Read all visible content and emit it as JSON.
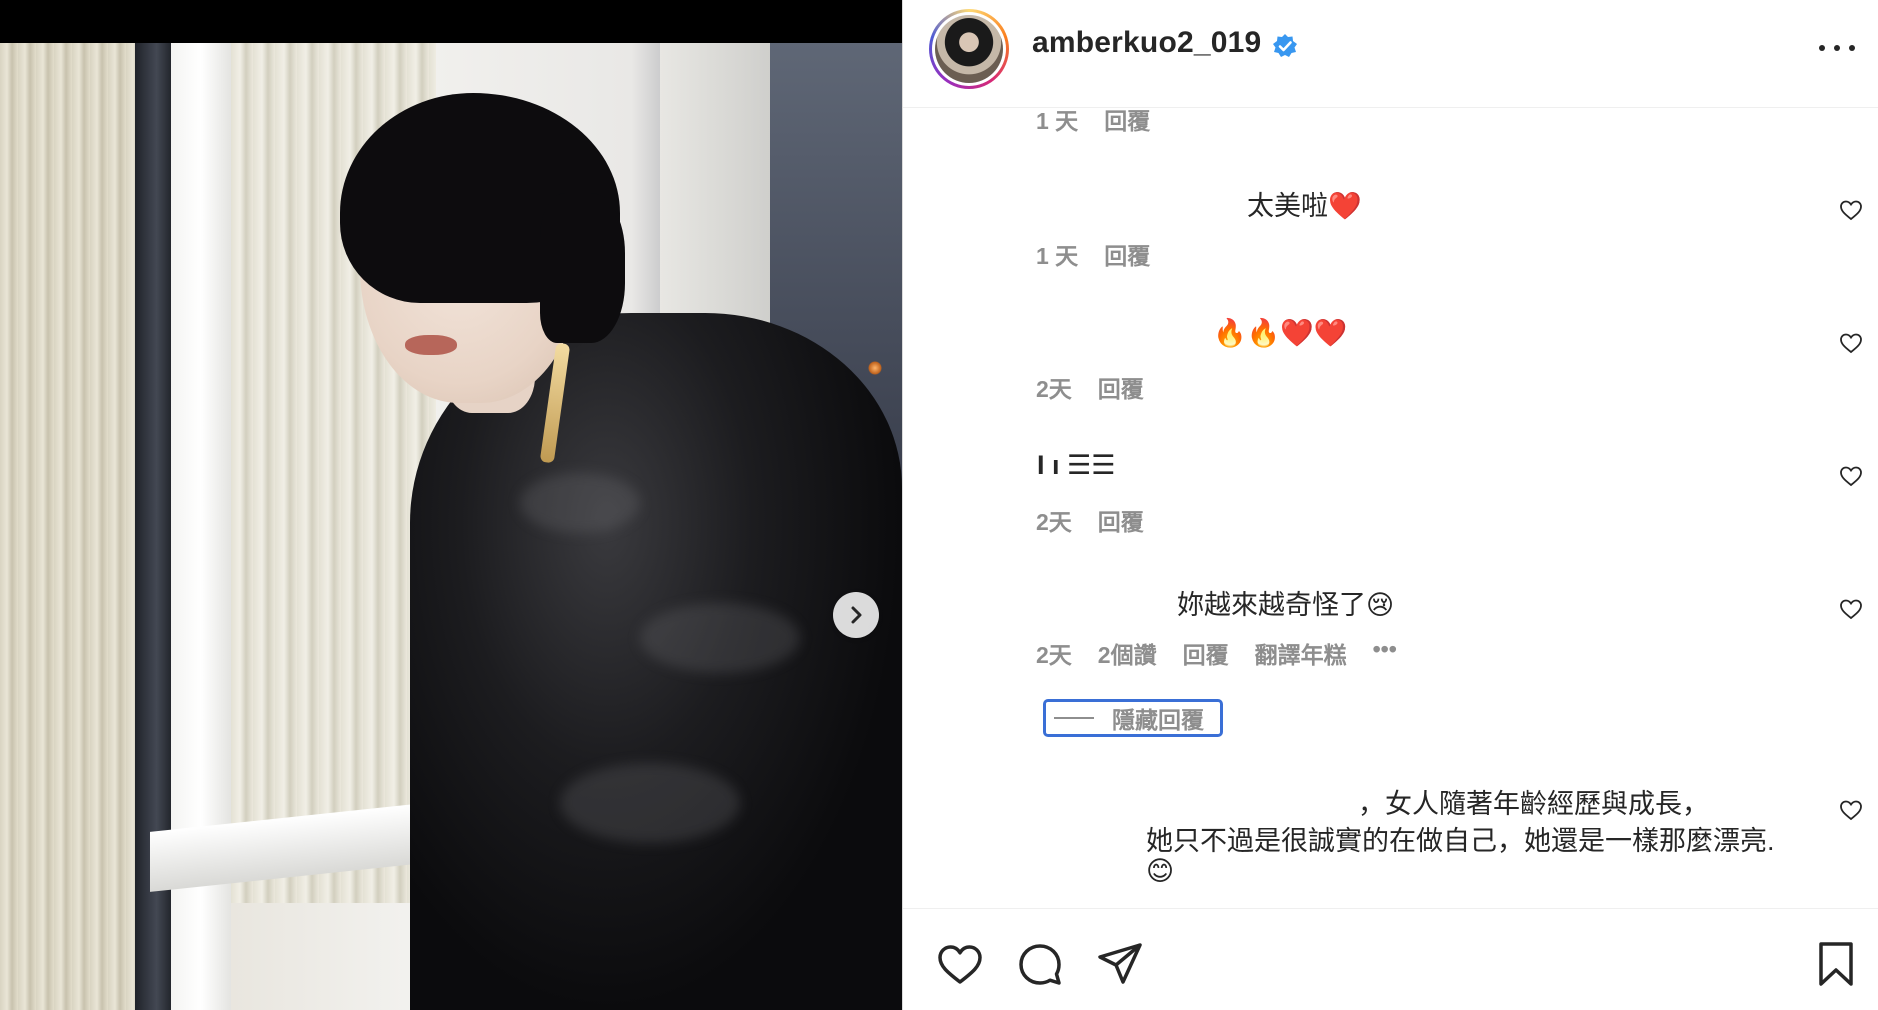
{
  "post": {
    "username": "amberkuo2_019",
    "verified": true
  },
  "comments": [
    {
      "text": "",
      "time": "1 天",
      "reply": "回覆"
    },
    {
      "text": "太美啦❤️",
      "time": "1 天",
      "reply": "回覆"
    },
    {
      "text": "🔥🔥❤️❤️",
      "time": "2天",
      "reply": "回覆"
    },
    {
      "text": "I           ı ☰☰",
      "time": "2天",
      "reply": "回覆"
    },
    {
      "text": "妳越來越奇怪了😢",
      "time": "2天",
      "likes": "2個讚",
      "reply": "回覆",
      "translate": "翻譯年糕",
      "more": "•••"
    },
    {
      "text_line1": "，女人隨著年齡經歷與成長，",
      "text_line2": "她只不過是很誠實的在做自己，她還是一樣那麼漂亮.",
      "text_line3": "😊"
    }
  ],
  "hide_replies_label": "隱藏回覆",
  "colors": {
    "verified_badge": "#3897f0",
    "link_highlight": "#3a6fd6",
    "meta_gray": "#8e8e8e",
    "text": "#262626"
  },
  "icons": [
    "chevron-right-icon",
    "verified-badge-icon",
    "more-icon",
    "heart-icon",
    "comment-icon",
    "share-icon",
    "bookmark-icon"
  ]
}
